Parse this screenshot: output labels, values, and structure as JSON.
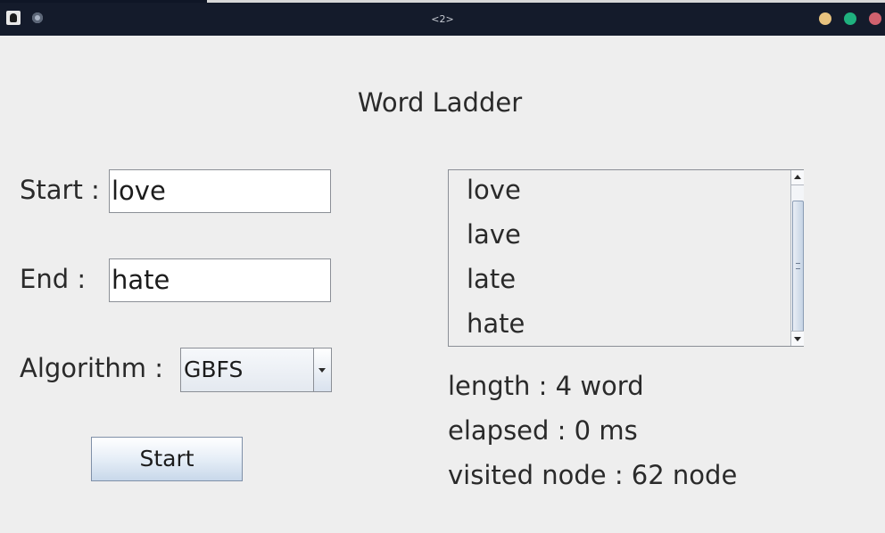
{
  "window": {
    "title": "<2>"
  },
  "heading": "Word Ladder",
  "form": {
    "start_label": "Start :",
    "start_value": "love",
    "end_label": "End :",
    "end_value": "hate",
    "algorithm_label": "Algorithm :",
    "algorithm_selected": "GBFS",
    "start_button": "Start"
  },
  "results": {
    "path": [
      "love",
      "lave",
      "late",
      "hate"
    ],
    "length_text": "length : 4 word",
    "elapsed_text": "elapsed : 0 ms",
    "visited_text": "visited node : 62 node"
  },
  "colors": {
    "titlebar": "#141b2b",
    "window_bg": "#eeeeee",
    "minimize": "#e7c27e",
    "maximize": "#1fb17e",
    "close": "#d0616e"
  }
}
